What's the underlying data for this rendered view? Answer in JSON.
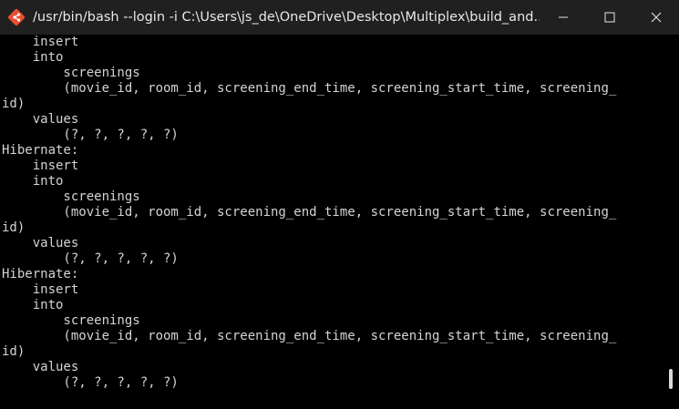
{
  "window": {
    "title": "/usr/bin/bash --login -i C:\\Users\\js_de\\OneDrive\\Desktop\\Multiplex\\build_and..."
  },
  "icons": {
    "app": "git-bash-icon",
    "minimize": "minimize-icon",
    "maximize": "maximize-icon",
    "close": "close-icon"
  },
  "terminal": {
    "lines": [
      "    insert",
      "    into",
      "        screenings",
      "        (movie_id, room_id, screening_end_time, screening_start_time, screening_",
      "id)",
      "    values",
      "        (?, ?, ?, ?, ?)",
      "Hibernate:",
      "    insert",
      "    into",
      "        screenings",
      "        (movie_id, room_id, screening_end_time, screening_start_time, screening_",
      "id)",
      "    values",
      "        (?, ?, ?, ?, ?)",
      "Hibernate:",
      "    insert",
      "    into",
      "        screenings",
      "        (movie_id, room_id, screening_end_time, screening_start_time, screening_",
      "id)",
      "    values",
      "        (?, ?, ?, ?, ?)"
    ]
  },
  "scrollbar": {
    "position_fraction": 0.98
  }
}
